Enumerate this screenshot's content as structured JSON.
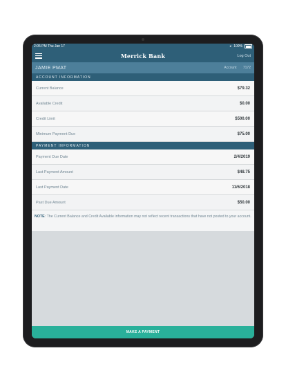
{
  "status": {
    "time": "2:05 PM",
    "date": "Thu Jan 17",
    "battery": "100%"
  },
  "header": {
    "brand": "Merrick Bank",
    "logout_label": "Log Out"
  },
  "user": {
    "name": "JAMIE PMAT",
    "account_label": "Account",
    "account_number": "7172"
  },
  "account_info": {
    "title": "ACCOUNT INFORMATION",
    "rows": [
      {
        "label": "Current Balance",
        "value": "$79.32"
      },
      {
        "label": "Available Credit",
        "value": "$0.00"
      },
      {
        "label": "Credit Limit",
        "value": "$500.00"
      },
      {
        "label": "Minimum Payment Due",
        "value": "$75.00"
      }
    ]
  },
  "payment_info": {
    "title": "PAYMENT INFORMATION",
    "rows": [
      {
        "label": "Payment Due Date",
        "value": "2/4/2019"
      },
      {
        "label": "Last Payment Amount",
        "value": "$48.75"
      },
      {
        "label": "Last Payment Date",
        "value": "11/6/2018"
      },
      {
        "label": "Past Due Amount",
        "value": "$50.00"
      }
    ]
  },
  "note": {
    "prefix": "NOTE",
    "text": ": The Current Balance and Credit Available information may not reflect recent transactions that have not posted to your account."
  },
  "actions": {
    "make_payment_label": "MAKE A PAYMENT"
  }
}
